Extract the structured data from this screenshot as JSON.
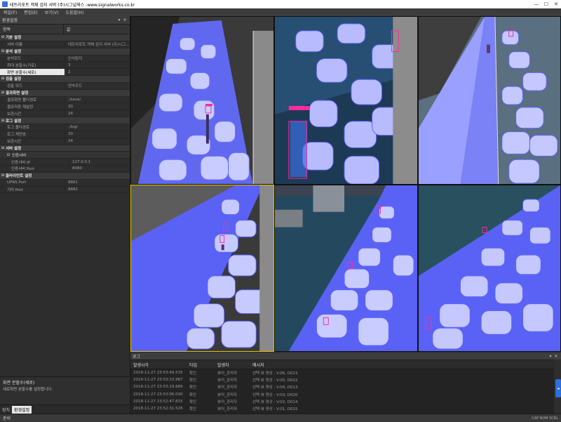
{
  "window": {
    "title": "테트라포트 객체 검지 서버 (주)시그널웍스 -www.signalworks.co.kr",
    "min": "—",
    "max": "☐",
    "close": "✕"
  },
  "menu": [
    "파일(F)",
    "편집(E)",
    "보기(V)",
    "도움말(H)"
  ],
  "env_panel": {
    "title": "환경설정",
    "pin": "▾",
    "close": "✕",
    "col_name": "항목",
    "col_value": "값",
    "rows": [
      {
        "type": "cat",
        "exp": "⊟",
        "label": "기본 설정"
      },
      {
        "type": "prop",
        "name": "서버 이름",
        "value": "테트라포트 객체 검지 서버 (주)시그..."
      },
      {
        "type": "cat",
        "exp": "⊟",
        "label": "분석 설정"
      },
      {
        "type": "prop",
        "name": "분석모드",
        "value": "인식탐지"
      },
      {
        "type": "prop",
        "name": "최대 분할수(가로)",
        "value": "3"
      },
      {
        "type": "prop",
        "name": "화면 분할수(세로)",
        "value": "2",
        "selected": true
      },
      {
        "type": "cat",
        "exp": "⊟",
        "label": "검출 설정"
      },
      {
        "type": "prop",
        "name": "검출 모드",
        "value": "연속모드"
      },
      {
        "type": "cat",
        "exp": "⊟",
        "label": "결과화면 설정"
      },
      {
        "type": "prop",
        "name": "결과화면 폴더경로",
        "value": "./save/"
      },
      {
        "type": "prop",
        "name": "결과저장 재설정",
        "value": "30"
      },
      {
        "type": "prop",
        "name": "보관시간",
        "value": "24"
      },
      {
        "type": "cat",
        "exp": "⊟",
        "label": "로그 설정"
      },
      {
        "type": "prop",
        "name": "로그 폴더경로",
        "value": "./log/"
      },
      {
        "type": "prop",
        "name": "로그 재전송",
        "value": "30"
      },
      {
        "type": "prop",
        "name": "보관시간",
        "value": "24"
      },
      {
        "type": "cat",
        "exp": "⊟",
        "label": "서버 설정"
      },
      {
        "type": "sub",
        "exp": "⊟",
        "label": "인증서버"
      },
      {
        "type": "prop",
        "sub": true,
        "name": "인증서버 IP",
        "value": "127.0.0.1"
      },
      {
        "type": "prop",
        "sub": true,
        "name": "인증서버 Port",
        "value": "8080"
      },
      {
        "type": "cat",
        "exp": "⊟",
        "label": "클라이언트 설정"
      },
      {
        "type": "prop",
        "name": "UPRS Port",
        "value": "8881"
      },
      {
        "type": "prop",
        "name": "기타 Port",
        "value": "8882"
      }
    ],
    "desc_title": "화면 분할수(세로)",
    "desc_text": "세로화면 분할수를 설정합니다.",
    "tabs": [
      "장치",
      "환경설정"
    ]
  },
  "log_panel": {
    "title": "로그",
    "pin": "▾",
    "close": "✕",
    "columns": [
      "발생시각",
      "타입",
      "발생자",
      "메시지"
    ],
    "rows": [
      {
        "time": "2018-11-27 23:53:49.535",
        "type": "확인",
        "source": "뷰어_관리자",
        "msg": "선택 뷰 영상 : V:06, D023"
      },
      {
        "time": "2018-11-27 23:53:33.987",
        "type": "확인",
        "source": "뷰어_관리자",
        "msg": "선택 뷰 영상 : V:05, D022"
      },
      {
        "time": "2018-11-27 23:53:19.689",
        "type": "확인",
        "source": "뷰어_관리자",
        "msg": "선택 뷰 영상 : V:04, D013"
      },
      {
        "time": "2018-11-27 23:53:06.030",
        "type": "확인",
        "source": "뷰어_관리자",
        "msg": "선택 뷰 영상 : V:03, D020"
      },
      {
        "time": "2018-11-27 23:52:47.815",
        "type": "확인",
        "source": "뷰어_관리자",
        "msg": "선택 뷰 영상 : V:02, D014"
      },
      {
        "time": "2018-11-27 23:52:31.526",
        "type": "확인",
        "source": "뷰어_관리자",
        "msg": "선택 뷰 영상 : V:01, D015"
      }
    ]
  },
  "status": {
    "text": "준비",
    "keys": "CAP  NUM  SCRL"
  },
  "colors": {
    "overlay": "#4a55ff",
    "selection": "#e6c400",
    "box": "#ff2aa0"
  }
}
